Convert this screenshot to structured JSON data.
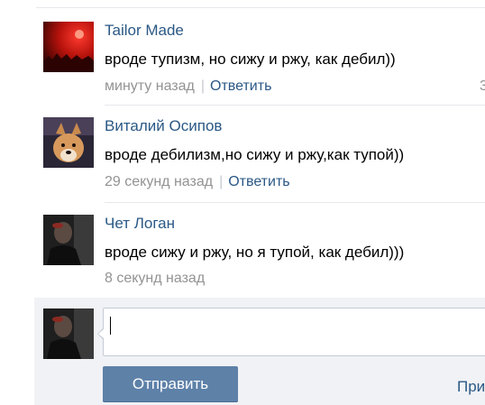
{
  "comments": [
    {
      "author": "Tailor Made",
      "text": "вроде тупизм, но сижу и ржу, как дебил))",
      "time": "минуту назад",
      "separator": "|",
      "reply": "Ответить",
      "avatar_icon": "red-concert-avatar-icon"
    },
    {
      "author": "Виталий Осипов",
      "text": "вроде дебилизм,но сижу и ржу,как тупой))",
      "time": "29 секунд назад",
      "separator": "|",
      "reply": "Ответить",
      "avatar_icon": "dog-avatar-icon"
    },
    {
      "author": "Чет Логан",
      "text": "вроде сижу и ржу, но я тупой, как дебил)))",
      "time": "8 секунд назад",
      "avatar_icon": "dark-person-avatar-icon"
    }
  ],
  "edge_digit": "3",
  "compose": {
    "input_value": "",
    "send_label": "Отправить",
    "attach_label": "При"
  },
  "colors": {
    "link": "#2a5885",
    "meta": "#939393",
    "button": "#5e81a8",
    "compose_bg": "#f0f2f5"
  }
}
